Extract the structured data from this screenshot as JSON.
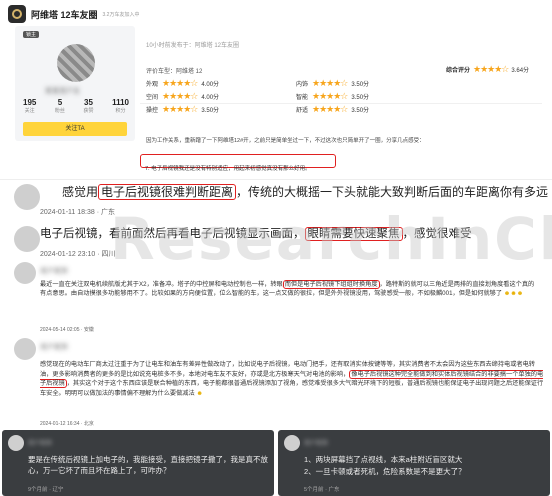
{
  "top_post": {
    "forum_name": "阿维塔 12车友圈",
    "member_count": "3.2万车友加入中",
    "time_line": "10小时前发布于：阿维塔 12车友圈",
    "user": {
      "level": "锁主",
      "stats": [
        {
          "value": "195",
          "label": "关注"
        },
        {
          "value": "5",
          "label": "粉丝"
        },
        {
          "value": "35",
          "label": "获赞"
        },
        {
          "value": "1110",
          "label": "积分"
        }
      ],
      "follow_button": "关注TA"
    },
    "rating": {
      "car_label": "评价车型：阿维塔 12",
      "overall_label": "综合评分",
      "overall_score": "3.64分",
      "items": [
        {
          "label": "外观",
          "score": "4.00分"
        },
        {
          "label": "内饰",
          "score": "3.50分"
        },
        {
          "label": "空间",
          "score": "4.00分"
        },
        {
          "label": "智能",
          "score": "3.50分"
        },
        {
          "label": "操控",
          "score": "3.50分"
        },
        {
          "label": "舒适",
          "score": "3.50分"
        }
      ]
    },
    "body_text": "因为工作关系，重新蹭了一下阿维塔12#开，之前只是简单坐过一下，不过这次也只简单开了一圈，分享几点感受：",
    "highlight_item": "7. 电子后视镜我还是没有特别适应，用起来初感觉真没有那么好用。"
  },
  "comments": [
    {
      "text_before": "感觉用",
      "text_highlight": "电子后视镜很难判断距离",
      "text_after": "，传统的大概摇一下头就能大致判断后面的车距离你有多远",
      "meta": "2024-01-11 18:38 · 广东"
    },
    {
      "text_before": "电子后视镜，看前面然后再看电子后视镜显示画面，",
      "text_highlight": "眼睛需要快速聚焦",
      "text_after": "，感觉很难受",
      "meta": "2024-01-12 23:10 · 四川"
    },
    {
      "text_before": "最近一直在关注双电机续航版尤其于X2，准备冲。塔子的中控屏和电动控制也一样，转眼",
      "text_highlight": "而但是电子后视镜下组组时换角度",
      "text_after": "，路特斯的就可以三角近是两排的直接划角度看这个真的有点意思。由自动摸很多功能够用不了。比较如果的方向便位置，位么智能的车，这一点又做的很拉，但是外外视镜没用，驾驶感受一般，不如极麟001，但是如何就够了",
      "meta": "2024-05-14 02:05 · 安徽"
    },
    {
      "text_before": "感觉现在的电动车厂商太过注重于为了让电车和油车有差异性做改动了，比如说电子后视镜，电动门把手，还有取消实体按键等等，其实消费者不太会因为这些东西去缔持电或者电转油，更多影响消费者的更多的是比如说充电桩多不多，本地对电车友不友好，亦或是北方极寒天气对电池的影响，",
      "text_highlight": "像电子后视镜这种完全能做到和实体后视镜结合的非要搞一个单独的电子后视镜",
      "text_after": "，其实这个对于这个东西应该是联合种植的东西，电子能都很普通后视镜添加了视角，感觉难受很多大气暗光环境下的短板，普通后视镜也能保证电子出现问题之后还能保证行车安全。明明可以做加法的事情偏不理解为什么要做减法",
      "meta": "2024-01-12 16:34 · 北京"
    }
  ],
  "bottom_left": {
    "text": "要是在传统后视镜上加电子的，我能接受，直接把镜子撒了，我是真不放心，万一它坏了而且坏在路上了，可咋办？",
    "meta": "9个月前 · 辽宁"
  },
  "bottom_right": {
    "line1": "1、两块屏幕挡了点视线，本来a柱附近盲区就大",
    "line2": "2、一旦卡顿或者死机，危险系数是不是更大了？",
    "meta": "5个月前 · 广东"
  },
  "watermark": "ResearchInChina"
}
